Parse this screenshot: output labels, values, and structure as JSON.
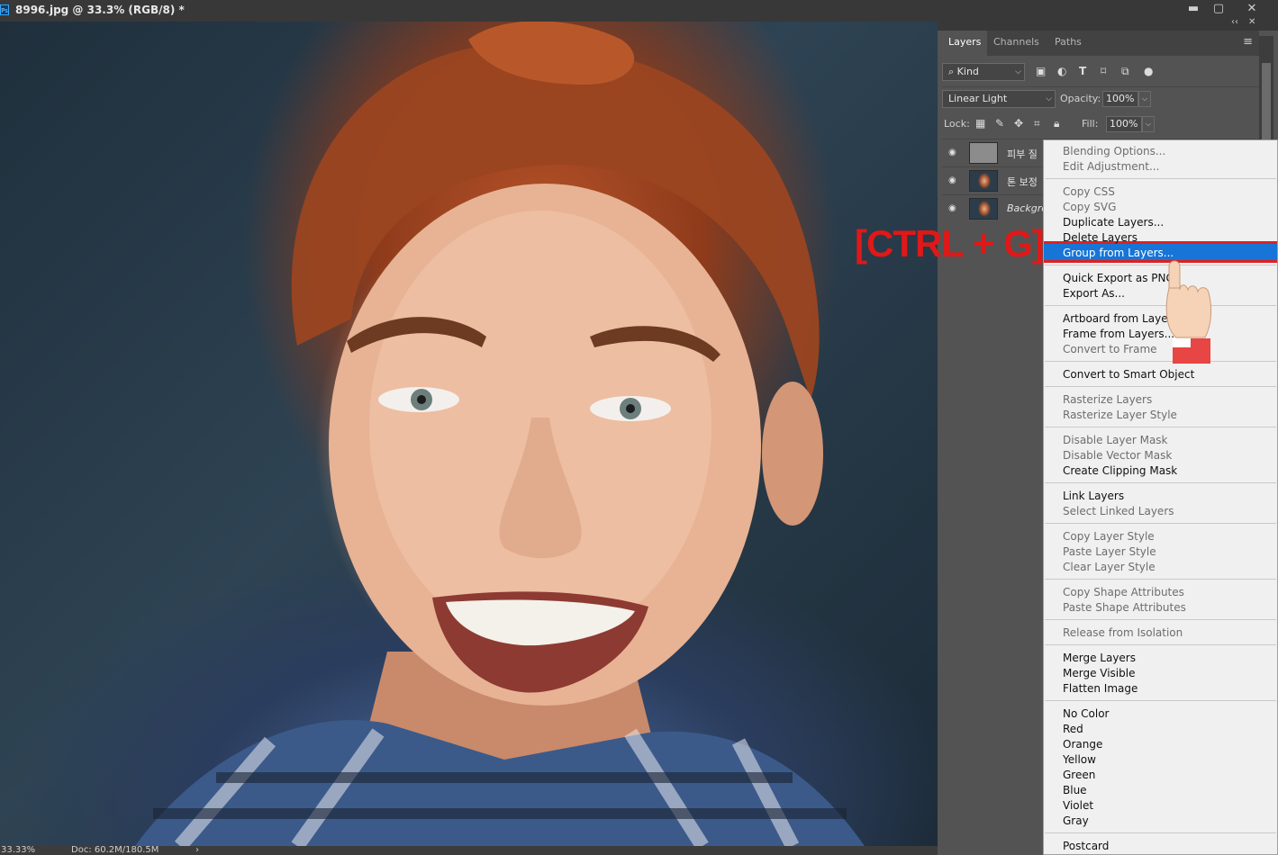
{
  "window": {
    "title": "8996.jpg @ 33.3% (RGB/8) *",
    "app_icon": "Ps",
    "minimize": "▬",
    "maximize": "▢",
    "close": "✕"
  },
  "status": {
    "zoom": "33.33%",
    "doc": "Doc: 60.2M/180.5M",
    "arrow": "›"
  },
  "panel": {
    "collapse_icon": "‹‹",
    "close_icon": "✕",
    "tabs": [
      {
        "label": "Layers",
        "active": true
      },
      {
        "label": "Channels",
        "active": false
      },
      {
        "label": "Paths",
        "active": false
      }
    ],
    "menu_icon": "≡",
    "filter": {
      "label": "Kind",
      "icons": [
        "image-filter-icon",
        "adjustment-filter-icon",
        "type-filter-icon",
        "shape-filter-icon",
        "smart-object-filter-icon"
      ]
    },
    "blend_mode": "Linear Light",
    "opacity_label": "Opacity:",
    "opacity_value": "100%",
    "lock_label": "Lock:",
    "fill_label": "Fill:",
    "fill_value": "100%",
    "layers": [
      {
        "name": "피부 질",
        "thumb": "gray",
        "italic": false
      },
      {
        "name": "톤 보정",
        "thumb": "photo",
        "italic": false
      },
      {
        "name": "Backgro",
        "thumb": "photo",
        "italic": true
      }
    ]
  },
  "overlay": {
    "shortcut": "[CTRL + G]"
  },
  "context_menu": {
    "groups": [
      [
        {
          "label": "Blending Options...",
          "enabled": false
        },
        {
          "label": "Edit Adjustment...",
          "enabled": false
        }
      ],
      [
        {
          "label": "Copy CSS",
          "enabled": false
        },
        {
          "label": "Copy SVG",
          "enabled": false
        },
        {
          "label": "Duplicate Layers...",
          "enabled": true
        },
        {
          "label": "Delete Layers",
          "enabled": true
        },
        {
          "label": "Group from Layers...",
          "enabled": true,
          "highlighted": true
        }
      ],
      [
        {
          "label": "Quick Export as PNG",
          "enabled": true
        },
        {
          "label": "Export As...",
          "enabled": true
        }
      ],
      [
        {
          "label": "Artboard from Layers...",
          "enabled": true
        },
        {
          "label": "Frame from Layers...",
          "enabled": true
        },
        {
          "label": "Convert to Frame",
          "enabled": false
        }
      ],
      [
        {
          "label": "Convert to Smart Object",
          "enabled": true
        }
      ],
      [
        {
          "label": "Rasterize Layers",
          "enabled": false
        },
        {
          "label": "Rasterize Layer Style",
          "enabled": false
        }
      ],
      [
        {
          "label": "Disable Layer Mask",
          "enabled": false
        },
        {
          "label": "Disable Vector Mask",
          "enabled": false
        },
        {
          "label": "Create Clipping Mask",
          "enabled": true
        }
      ],
      [
        {
          "label": "Link Layers",
          "enabled": true
        },
        {
          "label": "Select Linked Layers",
          "enabled": false
        }
      ],
      [
        {
          "label": "Copy Layer Style",
          "enabled": false
        },
        {
          "label": "Paste Layer Style",
          "enabled": false
        },
        {
          "label": "Clear Layer Style",
          "enabled": false
        }
      ],
      [
        {
          "label": "Copy Shape Attributes",
          "enabled": false
        },
        {
          "label": "Paste Shape Attributes",
          "enabled": false
        }
      ],
      [
        {
          "label": "Release from Isolation",
          "enabled": false
        }
      ],
      [
        {
          "label": "Merge Layers",
          "enabled": true
        },
        {
          "label": "Merge Visible",
          "enabled": true
        },
        {
          "label": "Flatten Image",
          "enabled": true
        }
      ],
      [
        {
          "label": "No Color",
          "enabled": true
        },
        {
          "label": "Red",
          "enabled": true
        },
        {
          "label": "Orange",
          "enabled": true
        },
        {
          "label": "Yellow",
          "enabled": true
        },
        {
          "label": "Green",
          "enabled": true
        },
        {
          "label": "Blue",
          "enabled": true
        },
        {
          "label": "Violet",
          "enabled": true
        },
        {
          "label": "Gray",
          "enabled": true
        }
      ],
      [
        {
          "label": "Postcard",
          "enabled": true
        }
      ]
    ]
  },
  "colors": {
    "highlight": "#1675d6",
    "highlight_border": "#e02020",
    "shortcut_text": "#e01818"
  }
}
